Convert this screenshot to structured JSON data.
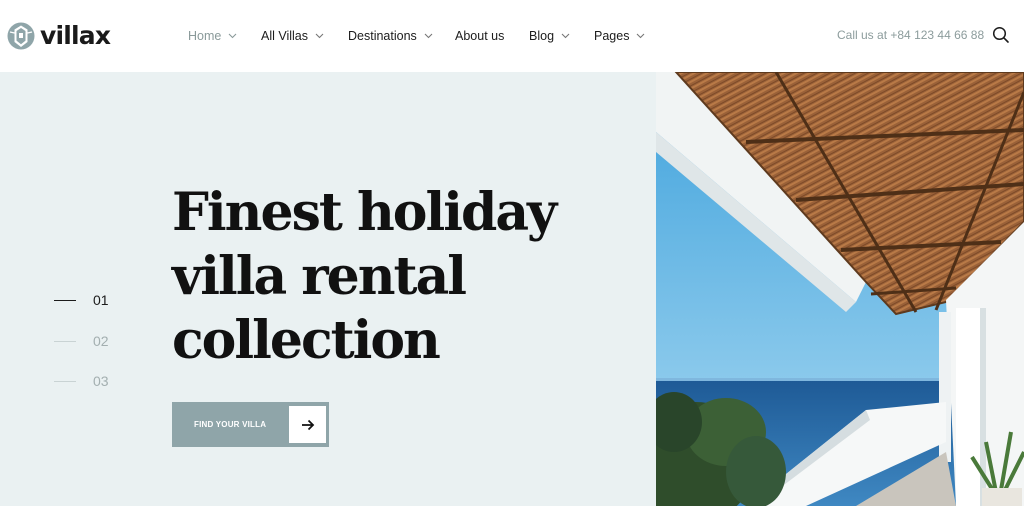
{
  "brand": {
    "name": "villax",
    "logo_icon": "villa-logo-icon",
    "accent_color": "#8fa5a9"
  },
  "nav": {
    "items": [
      {
        "label": "Home",
        "active": true,
        "has_dropdown": true
      },
      {
        "label": "All Villas",
        "active": false,
        "has_dropdown": true
      },
      {
        "label": "Destinations",
        "active": false,
        "has_dropdown": true
      },
      {
        "label": "About us",
        "active": false,
        "has_dropdown": false
      },
      {
        "label": "Blog",
        "active": false,
        "has_dropdown": true
      },
      {
        "label": "Pages",
        "active": false,
        "has_dropdown": true
      }
    ]
  },
  "header": {
    "call_label": "Call us at",
    "phone": "+84 123 44 66 88",
    "search_icon": "search-icon"
  },
  "hero": {
    "title_lines": [
      "Finest holiday",
      "villa rental",
      "collection"
    ],
    "slides": [
      "01",
      "02",
      "03"
    ],
    "active_slide": "01",
    "cta_label": "FIND YOUR VILLA",
    "cta_icon": "arrow-right-icon",
    "background_color": "#eaf1f2",
    "image_alt": "villa-terrace-sea-view-photo"
  }
}
